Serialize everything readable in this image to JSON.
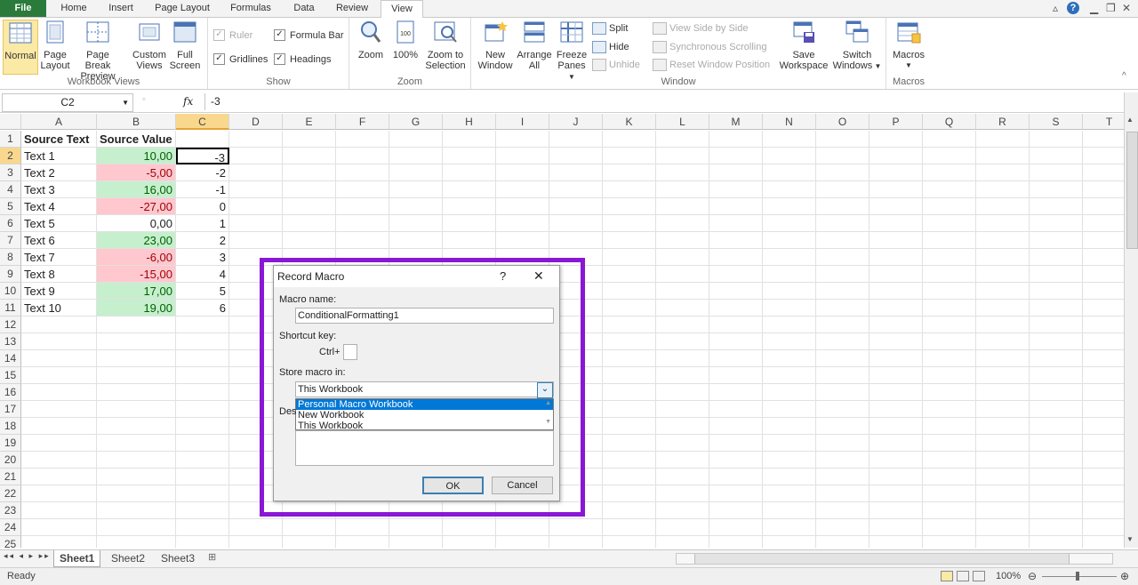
{
  "tabs": [
    "File",
    "Home",
    "Insert",
    "Page Layout",
    "Formulas",
    "Data",
    "Review",
    "View"
  ],
  "active_tab": "View",
  "ribbon": {
    "workbook_views": {
      "label": "Workbook Views",
      "normal": "Normal",
      "page_layout_1": "Page",
      "page_layout_2": "Layout",
      "page_break_1": "Page Break",
      "page_break_2": "Preview",
      "custom_1": "Custom",
      "custom_2": "Views",
      "full_1": "Full",
      "full_2": "Screen"
    },
    "show": {
      "label": "Show",
      "ruler": "Ruler",
      "formula_bar": "Formula Bar",
      "gridlines": "Gridlines",
      "headings": "Headings"
    },
    "zoom": {
      "label": "Zoom",
      "zoom": "Zoom",
      "hundred": "100%",
      "zts_1": "Zoom to",
      "zts_2": "Selection"
    },
    "window": {
      "label": "Window",
      "new_1": "New",
      "new_2": "Window",
      "arrange_1": "Arrange",
      "arrange_2": "All",
      "freeze_1": "Freeze",
      "freeze_2": "Panes",
      "split": "Split",
      "hide": "Hide",
      "unhide": "Unhide",
      "side": "View Side by Side",
      "sync": "Synchronous Scrolling",
      "reset": "Reset Window Position",
      "save_1": "Save",
      "save_2": "Workspace",
      "switch_1": "Switch",
      "switch_2": "Windows"
    },
    "macros": {
      "label": "Macros",
      "macros": "Macros"
    }
  },
  "formula_bar": {
    "name_box": "C2",
    "fx": "fx",
    "content": "-3"
  },
  "columns": [
    "A",
    "B",
    "C",
    "D",
    "E",
    "F",
    "G",
    "H",
    "I",
    "J",
    "K",
    "L",
    "M",
    "N",
    "O",
    "P",
    "Q",
    "R",
    "S",
    "T"
  ],
  "rows": [
    "1",
    "2",
    "3",
    "4",
    "5",
    "6",
    "7",
    "8",
    "9",
    "10",
    "11",
    "12",
    "13",
    "14",
    "15",
    "16",
    "17",
    "18",
    "19",
    "20",
    "21",
    "22",
    "23",
    "24",
    "25"
  ],
  "headers": {
    "a1": "Source Text",
    "b1": "Source Value"
  },
  "data_rows": [
    {
      "text": "Text 1",
      "value": "10,00",
      "c": "-3",
      "sign": "pos"
    },
    {
      "text": "Text 2",
      "value": "-5,00",
      "c": "-2",
      "sign": "neg"
    },
    {
      "text": "Text 3",
      "value": "16,00",
      "c": "-1",
      "sign": "pos"
    },
    {
      "text": "Text 4",
      "value": "-27,00",
      "c": "0",
      "sign": "neg"
    },
    {
      "text": "Text 5",
      "value": "0,00",
      "c": "1",
      "sign": "none"
    },
    {
      "text": "Text 6",
      "value": "23,00",
      "c": "2",
      "sign": "pos"
    },
    {
      "text": "Text 7",
      "value": "-6,00",
      "c": "3",
      "sign": "neg"
    },
    {
      "text": "Text 8",
      "value": "-15,00",
      "c": "4",
      "sign": "neg"
    },
    {
      "text": "Text 9",
      "value": "17,00",
      "c": "5",
      "sign": "pos"
    },
    {
      "text": "Text 10",
      "value": "19,00",
      "c": "6",
      "sign": "pos"
    }
  ],
  "sheets": [
    "Sheet1",
    "Sheet2",
    "Sheet3"
  ],
  "status": {
    "ready": "Ready",
    "zoom": "100%"
  },
  "dialog": {
    "title": "Record Macro",
    "help": "?",
    "close": "✕",
    "macro_name_label": "Macro name:",
    "macro_name_value": "ConditionalFormatting1",
    "shortcut_label": "Shortcut key:",
    "ctrl": "Ctrl+",
    "store_label": "Store macro in:",
    "store_value": "This Workbook",
    "options": [
      "Personal Macro Workbook",
      "New Workbook",
      "This Workbook"
    ],
    "desc_label": "Des",
    "ok": "OK",
    "cancel": "Cancel"
  }
}
